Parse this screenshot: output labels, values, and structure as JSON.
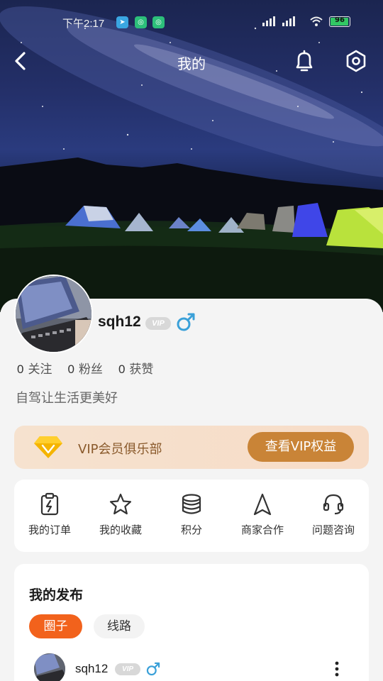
{
  "status_bar": {
    "time": "下午2:17",
    "battery": "96",
    "battery_level": 0.96
  },
  "header": {
    "title": "我的",
    "icons": [
      "back-icon",
      "bell-icon",
      "settings-icon"
    ]
  },
  "profile": {
    "username": "sqh12",
    "vip_badge": "VIP",
    "gender": "male",
    "stats": [
      {
        "count": "0",
        "label": "关注"
      },
      {
        "count": "0",
        "label": "粉丝"
      },
      {
        "count": "0",
        "label": "获赞"
      }
    ],
    "bio": "自驾让生活更美好"
  },
  "vip_banner": {
    "label": "VIP会员俱乐部",
    "button": "查看VIP权益"
  },
  "quick_menu": [
    {
      "label": "我的订单",
      "icon": "order-icon"
    },
    {
      "label": "我的收藏",
      "icon": "star-icon"
    },
    {
      "label": "积分",
      "icon": "coins-icon"
    },
    {
      "label": "商家合作",
      "icon": "navigation-icon"
    },
    {
      "label": "问题咨询",
      "icon": "headset-icon"
    }
  ],
  "posts": {
    "title": "我的发布",
    "tabs": [
      {
        "label": "圈子",
        "active": true
      },
      {
        "label": "线路",
        "active": false
      }
    ],
    "items": [
      {
        "author": "sqh12",
        "vip_badge": "VIP"
      }
    ]
  },
  "colors": {
    "accent_orange": "#f2621c",
    "vip_button": "#c98437",
    "vip_banner_bg": "#f6e2cf",
    "male_blue": "#3aa0d8"
  }
}
